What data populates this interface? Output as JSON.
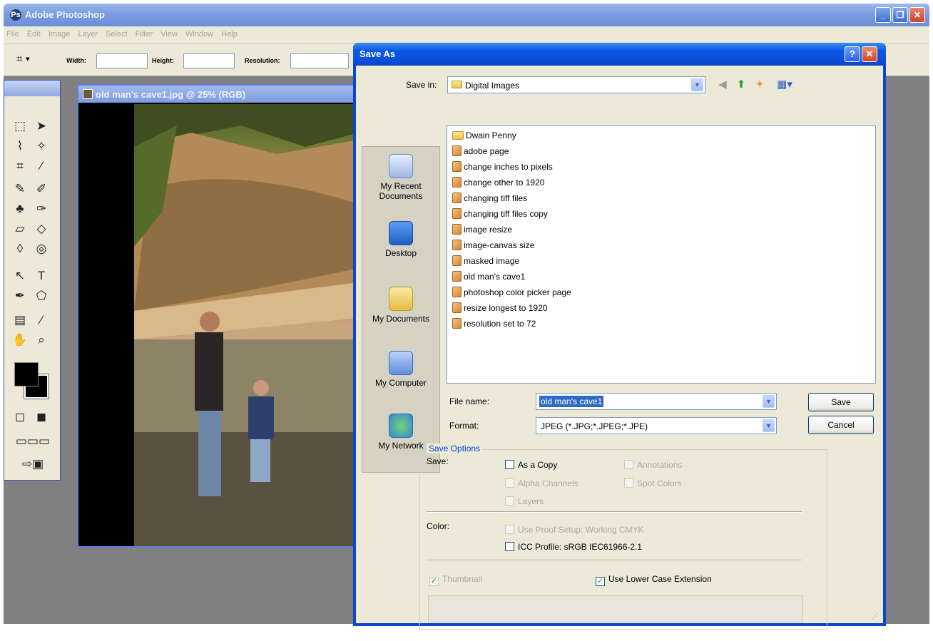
{
  "app": {
    "title": "Adobe Photoshop"
  },
  "menubar": [
    "File",
    "Edit",
    "Image",
    "Layer",
    "Select",
    "Filter",
    "View",
    "Window",
    "Help"
  ],
  "options_bar": {
    "width_label": "Width:",
    "height_label": "Height:",
    "resolution_label": "Resolution:"
  },
  "document": {
    "title": "old man's cave1.jpg @ 25% (RGB)"
  },
  "dialog": {
    "title": "Save As",
    "save_in_label": "Save in:",
    "save_in_value": "Digital Images",
    "places": [
      "My Recent Documents",
      "Desktop",
      "My Documents",
      "My Computer",
      "My Network"
    ],
    "files": [
      "Dwain Penny",
      "adobe page",
      "change inches to pixels",
      "change other to 1920",
      "changing tiff files",
      "changing tiff files copy",
      "image resize",
      "image-canvas size",
      "masked image",
      "old man's cave1",
      "photoshop color picker page",
      "resize longest to 1920",
      "resolution set to 72"
    ],
    "file_name_label": "File name:",
    "file_name_value": "old man's cave1",
    "format_label": "Format:",
    "format_value": "JPEG (*.JPG;*.JPEG;*.JPE)",
    "save_button": "Save",
    "cancel_button": "Cancel",
    "save_options": {
      "title": "Save Options",
      "save_label": "Save:",
      "as_a_copy": "As a Copy",
      "annotations": "Annotations",
      "alpha_channels": "Alpha Channels",
      "spot_colors": "Spot Colors",
      "layers": "Layers",
      "color_label": "Color:",
      "use_proof_setup": "Use Proof Setup:  Working CMYK",
      "icc_profile": "ICC Profile:  sRGB IEC61966-2.1",
      "thumbnail": "Thumbnail",
      "use_lower_case_extension": "Use Lower Case Extension"
    }
  },
  "colors": {
    "xp_title": "#0a58e6",
    "dialog_body": "#ece9d8",
    "selection": "#316ac5",
    "workspace": "#808080"
  }
}
